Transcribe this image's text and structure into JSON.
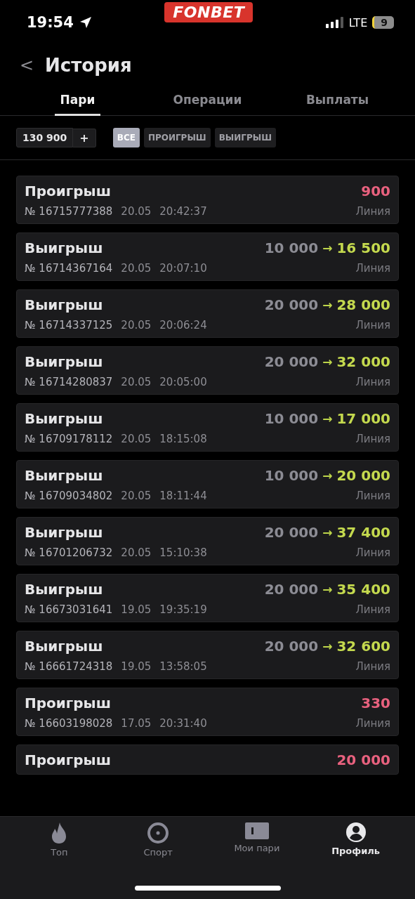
{
  "status_bar": {
    "time": "19:54",
    "logo": "FONBET",
    "network": "LTE",
    "battery": "9"
  },
  "header": {
    "back": "<",
    "title": "История"
  },
  "tabs": [
    {
      "label": "Пари",
      "selected": true
    },
    {
      "label": "Операции",
      "selected": false
    },
    {
      "label": "Выплаты",
      "selected": false
    }
  ],
  "filters": {
    "amount": "130 900",
    "add": "+",
    "chips": [
      {
        "label": "ВСЕ",
        "selected": true
      },
      {
        "label": "ПРОИГРЫШ",
        "selected": false
      },
      {
        "label": "ВЫИГРЫШ",
        "selected": false
      }
    ]
  },
  "bets": [
    {
      "kind": "loss",
      "title": "Проигрыш",
      "amount": "900",
      "number": "№ 16715777388",
      "date": "20.05",
      "time": "20:42:37",
      "type": "Линия"
    },
    {
      "kind": "win",
      "title": "Выигрыш",
      "stake": "10 000",
      "arrow": "→",
      "amount": "16 500",
      "number": "№ 16714367164",
      "date": "20.05",
      "time": "20:07:10",
      "type": "Линия"
    },
    {
      "kind": "win",
      "title": "Выигрыш",
      "stake": "20 000",
      "arrow": "→",
      "amount": "28 000",
      "number": "№ 16714337125",
      "date": "20.05",
      "time": "20:06:24",
      "type": "Линия"
    },
    {
      "kind": "win",
      "title": "Выигрыш",
      "stake": "20 000",
      "arrow": "→",
      "amount": "32 000",
      "number": "№ 16714280837",
      "date": "20.05",
      "time": "20:05:00",
      "type": "Линия"
    },
    {
      "kind": "win",
      "title": "Выигрыш",
      "stake": "10 000",
      "arrow": "→",
      "amount": "17 000",
      "number": "№ 16709178112",
      "date": "20.05",
      "time": "18:15:08",
      "type": "Линия"
    },
    {
      "kind": "win",
      "title": "Выигрыш",
      "stake": "10 000",
      "arrow": "→",
      "amount": "20 000",
      "number": "№ 16709034802",
      "date": "20.05",
      "time": "18:11:44",
      "type": "Линия"
    },
    {
      "kind": "win",
      "title": "Выигрыш",
      "stake": "20 000",
      "arrow": "→",
      "amount": "37 400",
      "number": "№ 16701206732",
      "date": "20.05",
      "time": "15:10:38",
      "type": "Линия"
    },
    {
      "kind": "win",
      "title": "Выигрыш",
      "stake": "20 000",
      "arrow": "→",
      "amount": "35 400",
      "number": "№ 16673031641",
      "date": "19.05",
      "time": "19:35:19",
      "type": "Линия"
    },
    {
      "kind": "win",
      "title": "Выигрыш",
      "stake": "20 000",
      "arrow": "→",
      "amount": "32 600",
      "number": "№ 16661724318",
      "date": "19.05",
      "time": "13:58:05",
      "type": "Линия"
    },
    {
      "kind": "loss",
      "title": "Проигрыш",
      "amount": "330",
      "number": "№ 16603198028",
      "date": "17.05",
      "time": "20:31:40",
      "type": "Линия"
    },
    {
      "kind": "loss",
      "title": "Проигрыш",
      "amount": "20 000"
    }
  ],
  "nav": [
    {
      "kind": "top",
      "label": "Топ",
      "selected": false
    },
    {
      "kind": "sport",
      "label": "Спорт",
      "selected": false
    },
    {
      "kind": "bets",
      "label": "Мои пари",
      "selected": false
    },
    {
      "kind": "profile",
      "label": "Профиль",
      "selected": true
    }
  ]
}
